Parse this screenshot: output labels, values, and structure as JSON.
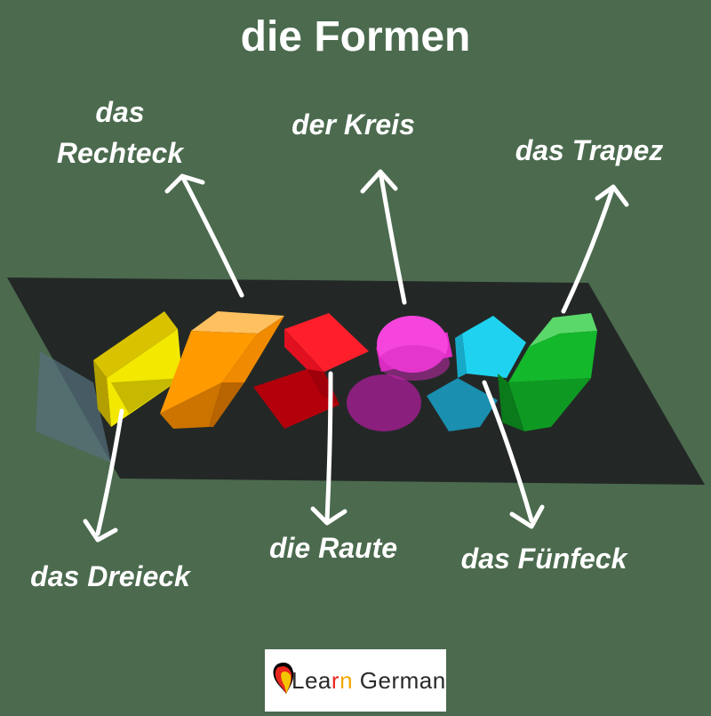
{
  "title": "die Formen",
  "labels": {
    "rechteck_line1": "das",
    "rechteck_line2": "Rechteck",
    "kreis": "der Kreis",
    "trapez": "das Trapez",
    "dreieck": "das Dreieck",
    "raute": "die Raute",
    "fuenfeck": "das Fünfeck"
  },
  "logo": {
    "part1": "Lea",
    "part2": "r",
    "part3": "n",
    "part4": " German"
  },
  "colors": {
    "background": "#4b6a4e",
    "table": "#232826",
    "triangle": "#f2dd00",
    "rectangle": "#ff9500",
    "rhombus": "#ff1f2a",
    "circle": "#f23bd8",
    "pentagon": "#1fd2f0",
    "trapezoid": "#11b82a",
    "arrow": "#ffffff"
  },
  "icons": [
    "germany-flag-icon"
  ]
}
